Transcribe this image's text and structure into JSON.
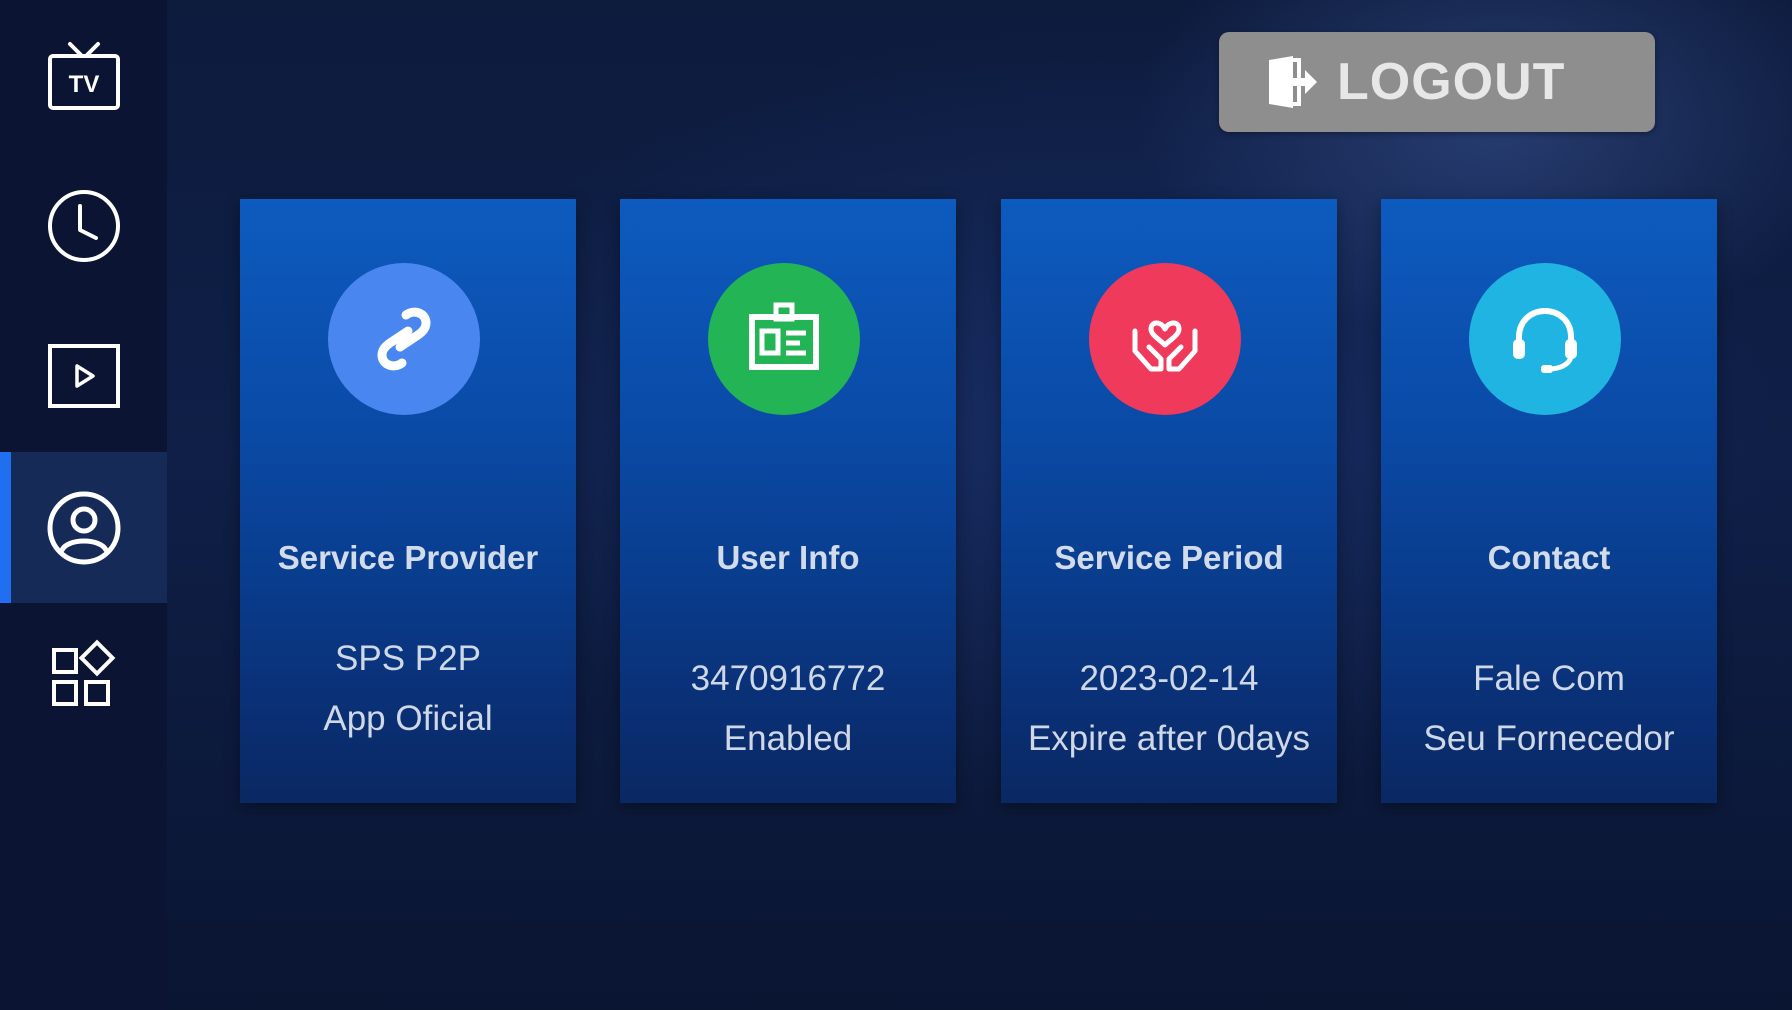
{
  "sidebar": {
    "items": [
      {
        "id": "tv",
        "label": "TV",
        "icon": "tv-icon",
        "active": false
      },
      {
        "id": "history",
        "icon": "clock-icon",
        "active": false
      },
      {
        "id": "video",
        "icon": "play-icon",
        "active": false
      },
      {
        "id": "account",
        "icon": "user-circle-icon",
        "active": true
      },
      {
        "id": "apps",
        "icon": "apps-grid-icon",
        "active": false
      }
    ]
  },
  "header": {
    "logout_label": "LOGOUT",
    "logout_icon": "logout-icon"
  },
  "cards": [
    {
      "title": "Service Provider",
      "line1": "SPS P2P",
      "line2": "App Oficial",
      "icon": "link-icon",
      "color": "#4a86f0"
    },
    {
      "title": "User Info",
      "line1": "3470916772",
      "line2": "Enabled",
      "icon": "id-card-icon",
      "color": "#22b455"
    },
    {
      "title": "Service Period",
      "line1": "2023-02-14",
      "line2": "Expire after 0days",
      "icon": "hands-heart-icon",
      "color": "#f03a5c"
    },
    {
      "title": "Contact",
      "line1": "Fale Com",
      "line2": "Seu Fornecedor",
      "icon": "headset-icon",
      "color": "#1fb4e2"
    }
  ],
  "colors": {
    "accent": "#1f6ff0",
    "background": "#0d1b3d",
    "card": "#0a4aa6",
    "logout_button": "#8e8e8e"
  }
}
